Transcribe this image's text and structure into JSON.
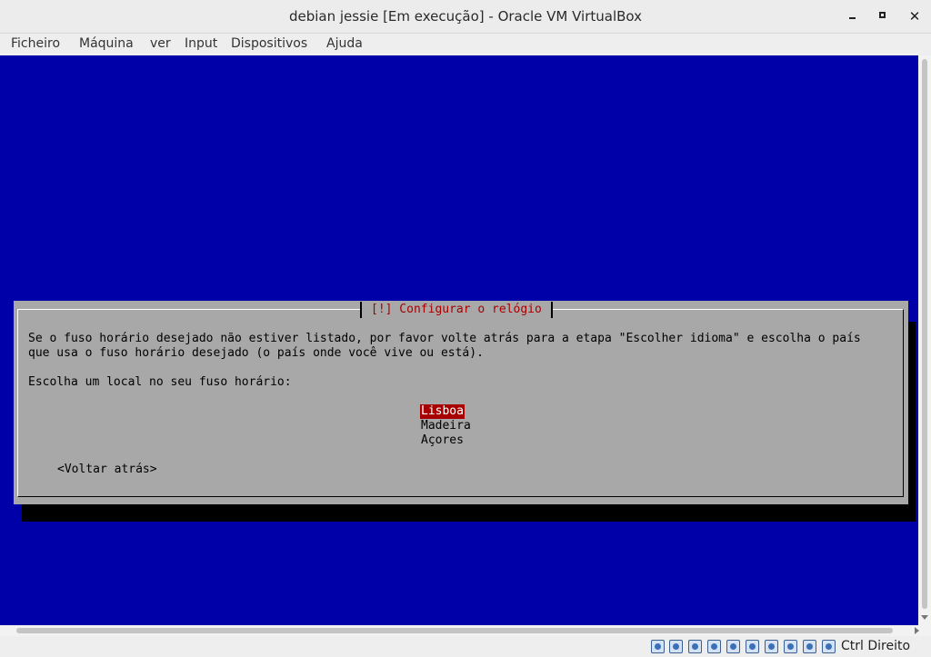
{
  "window": {
    "title": "debian jessie [Em execução] - Oracle VM VirtualBox",
    "icons": [
      "minimize-icon",
      "maximize-icon",
      "close-icon"
    ]
  },
  "menu": {
    "items": [
      "Ficheiro",
      "Máquina",
      "ver",
      "Input",
      "Dispositivos",
      "Ajuda"
    ]
  },
  "installer": {
    "dialog_title": "[!] Configurar o relógio",
    "message_line1": "Se o fuso horário desejado não estiver listado, por favor volte atrás para a etapa \"Escolher idioma\" e escolha o país",
    "message_line2": "que usa o fuso horário desejado (o país onde você vive ou está).",
    "prompt": "Escolha um local no seu fuso horário:",
    "options": [
      "Lisboa",
      "Madeira",
      "Açores"
    ],
    "selected_option": "Lisboa",
    "back_button": "<Voltar atrás>",
    "colors": {
      "background": "#0000a8",
      "dialog": "#a8a8a8",
      "title": "#a80000",
      "selection": "#a80000"
    }
  },
  "statusbar": {
    "host_key": "Ctrl Direito",
    "icons": [
      "hard-disk-icon",
      "optical-drive-icon",
      "audio-icon",
      "network-icon",
      "usb-icon",
      "shared-folder-icon",
      "display-icon",
      "video-capture-icon",
      "cpu-icon",
      "mouse-integration-icon",
      "keyboard-icon"
    ]
  }
}
